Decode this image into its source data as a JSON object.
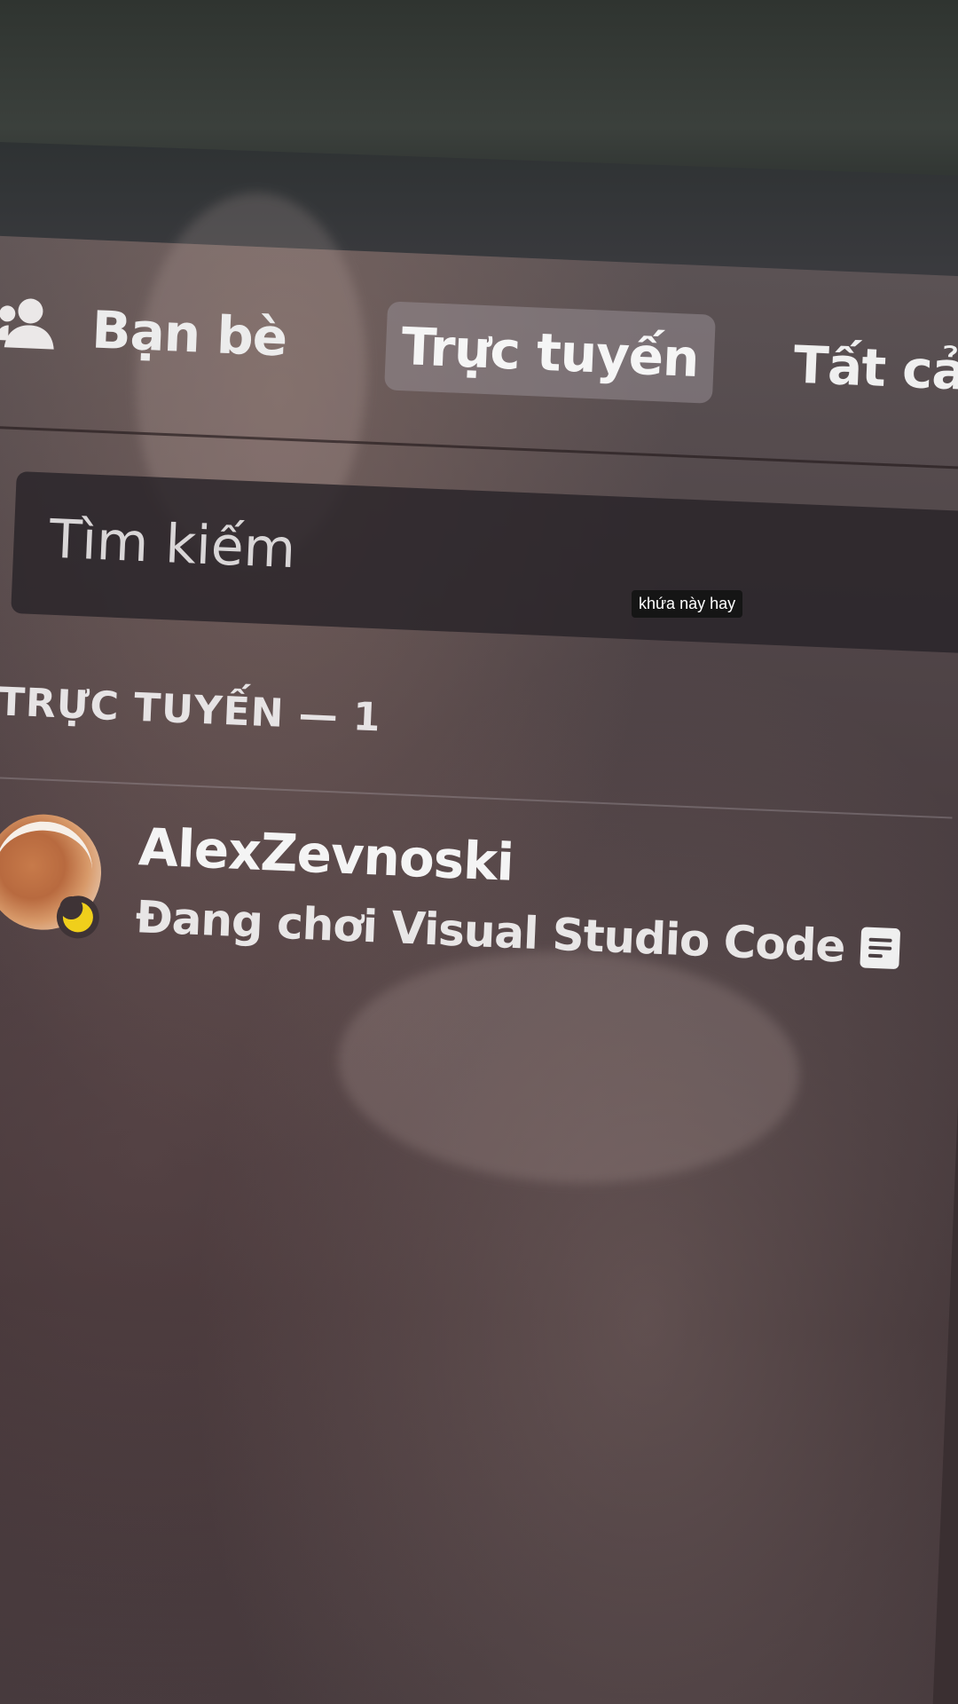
{
  "header": {
    "friends_icon": "friends-icon",
    "friends_title": "Bạn bè",
    "tabs": [
      {
        "label": "Trực tuyến",
        "active": true
      },
      {
        "label": "Tất cả",
        "active": false
      }
    ]
  },
  "search": {
    "placeholder": "Tìm kiếm"
  },
  "section": {
    "label": "TRỰC TUYẾN — 1"
  },
  "friends": [
    {
      "name": "AlexZevnoski",
      "activity": "Đang chơi Visual Studio Code",
      "status": "idle",
      "status_icon": "moon-icon",
      "activity_icon": "rich-presence-icon"
    }
  ],
  "caption": "khứa này hay",
  "colors": {
    "idle_status": "#f0cf1b",
    "active_tab_bg": "#968c91",
    "search_bg": "#28232a"
  }
}
